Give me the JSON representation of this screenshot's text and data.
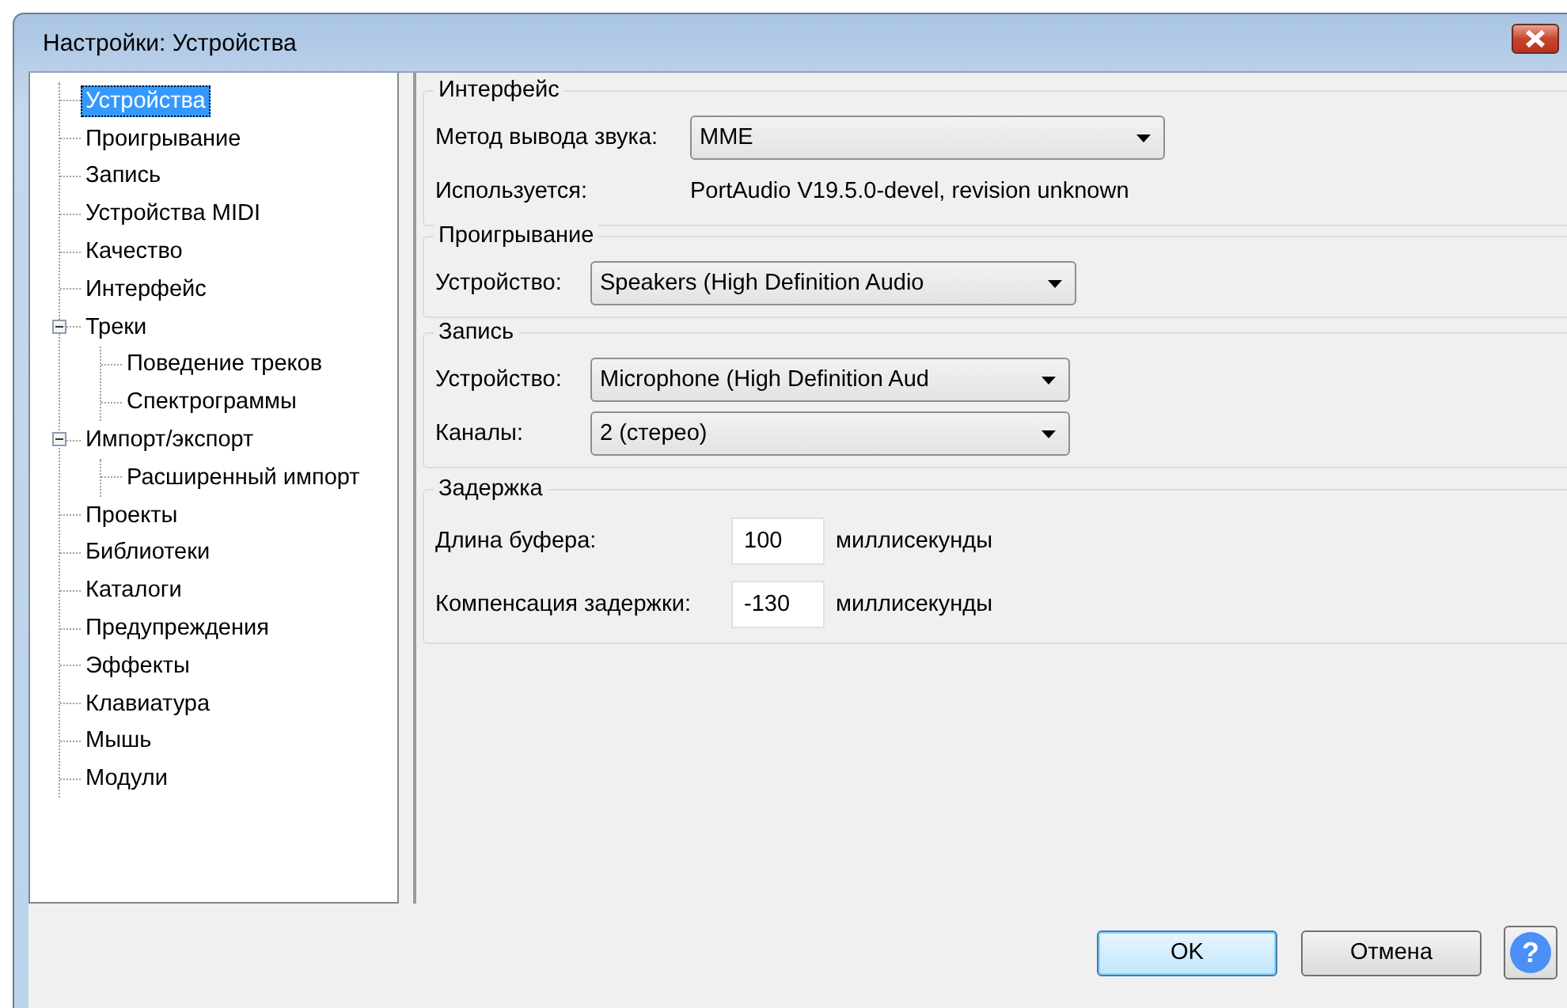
{
  "window": {
    "title": "Настройки: Устройства"
  },
  "tree": [
    {
      "label": "Устройства",
      "selected": true
    },
    {
      "label": "Проигрывание",
      "selected": false
    },
    {
      "label": "Запись",
      "selected": false
    },
    {
      "label": "Устройства MIDI",
      "selected": false
    },
    {
      "label": "Качество",
      "selected": false
    },
    {
      "label": "Интерфейс",
      "selected": false
    },
    {
      "label": "Треки",
      "selected": false,
      "expanded": true,
      "children": [
        {
          "label": "Поведение треков",
          "selected": false
        },
        {
          "label": "Спектрограммы",
          "selected": false
        }
      ]
    },
    {
      "label": "Импорт/экспорт",
      "selected": false,
      "expanded": true,
      "children": [
        {
          "label": "Расширенный импорт",
          "selected": false
        }
      ]
    },
    {
      "label": "Проекты",
      "selected": false
    },
    {
      "label": "Библиотеки",
      "selected": false
    },
    {
      "label": "Каталоги",
      "selected": false
    },
    {
      "label": "Предупреждения",
      "selected": false
    },
    {
      "label": "Эффекты",
      "selected": false
    },
    {
      "label": "Клавиатура",
      "selected": false
    },
    {
      "label": "Мышь",
      "selected": false
    },
    {
      "label": "Модули",
      "selected": false
    }
  ],
  "groups": [
    {
      "title": "Интерфейс",
      "rows": [
        {
          "kind": "dropdown",
          "label": "Метод вывода звука:",
          "value": "MME"
        },
        {
          "kind": "info",
          "label": "Используется:",
          "value": "PortAudio V19.5.0-devel, revision unknown"
        }
      ]
    },
    {
      "title": "Проигрывание",
      "rows": [
        {
          "kind": "dropdown",
          "label": "Устройство:",
          "value": "Speakers (High Definition Audio"
        }
      ]
    },
    {
      "title": "Запись",
      "rows": [
        {
          "kind": "dropdown",
          "label": "Устройство:",
          "value": "Microphone (High Definition Aud"
        },
        {
          "kind": "dropdown",
          "label": "Каналы:",
          "value": "2 (стерео)"
        }
      ]
    },
    {
      "title": "Задержка",
      "rows": [
        {
          "kind": "number",
          "label": "Длина буфера:",
          "value": "100",
          "unit": "миллисекунды"
        },
        {
          "kind": "number",
          "label": "Компенсация задержки:",
          "value": "-130",
          "unit": "миллисекунды"
        }
      ]
    }
  ],
  "buttons": [
    {
      "label": "OK",
      "default": true
    },
    {
      "label": "Отмена",
      "default": false
    }
  ],
  "help_button": "?"
}
